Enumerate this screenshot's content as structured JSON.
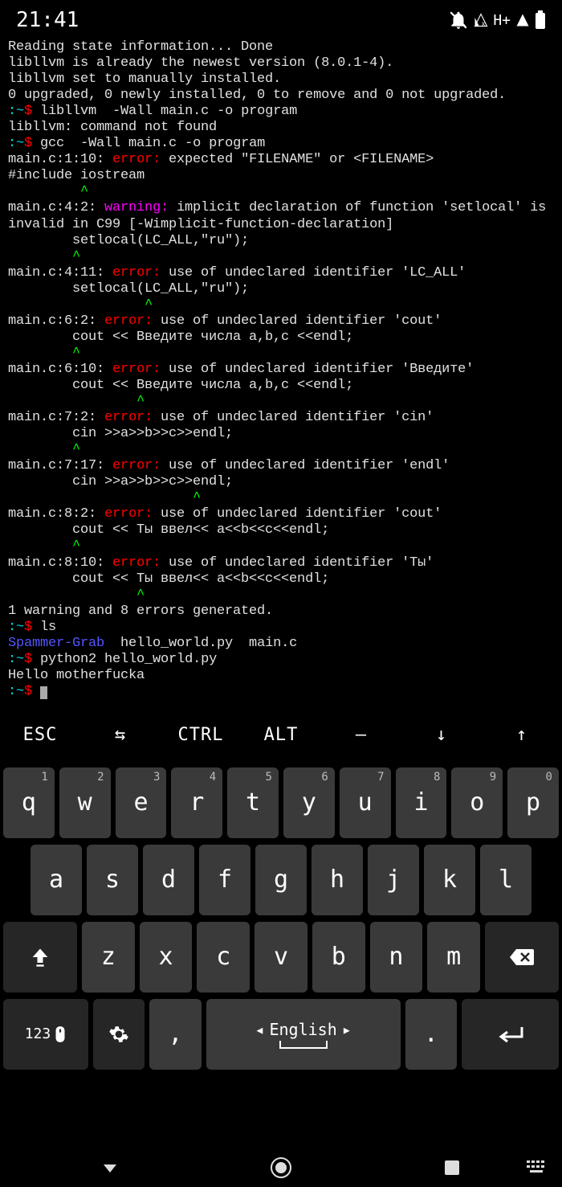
{
  "status": {
    "time": "21:41",
    "network": "H+"
  },
  "terminal": {
    "lines": [
      {
        "segs": [
          {
            "t": "Reading state information... Done"
          }
        ]
      },
      {
        "segs": [
          {
            "t": "libllvm is already the newest version (8.0.1-4)."
          }
        ]
      },
      {
        "segs": [
          {
            "t": "libllvm set to manually installed."
          }
        ]
      },
      {
        "segs": [
          {
            "t": "0 upgraded, 0 newly installed, 0 to remove and 0 not upgraded."
          }
        ]
      },
      {
        "prompt": true,
        "cmd": " libllvm  -Wall main.c -o program"
      },
      {
        "segs": [
          {
            "t": "libllvm: command not found"
          }
        ]
      },
      {
        "prompt": true,
        "cmd": " gcc  -Wall main.c -o program"
      },
      {
        "segs": [
          {
            "t": "main.c:1:10: ",
            "c": ""
          },
          {
            "t": "error:",
            "c": "t-red"
          },
          {
            "t": " expected \"FILENAME\" or <FILENAME>"
          }
        ]
      },
      {
        "segs": [
          {
            "t": "#include iostream"
          }
        ]
      },
      {
        "segs": [
          {
            "t": "         ^",
            "c": "t-green"
          }
        ]
      },
      {
        "segs": [
          {
            "t": "main.c:4:2: "
          },
          {
            "t": "warning:",
            "c": "t-magenta"
          },
          {
            "t": " implicit declaration of function 'setlocal' is invalid in C99 [-Wimplicit-function-declaration]"
          }
        ]
      },
      {
        "segs": [
          {
            "t": "        setlocal(LC_ALL,\"ru\");"
          }
        ]
      },
      {
        "segs": [
          {
            "t": "        ^",
            "c": "t-green"
          }
        ]
      },
      {
        "segs": [
          {
            "t": "main.c:4:11: "
          },
          {
            "t": "error:",
            "c": "t-red"
          },
          {
            "t": " use of undeclared identifier 'LC_ALL'"
          }
        ]
      },
      {
        "segs": [
          {
            "t": "        setlocal(LC_ALL,\"ru\");"
          }
        ]
      },
      {
        "segs": [
          {
            "t": "                 ^",
            "c": "t-green"
          }
        ]
      },
      {
        "segs": [
          {
            "t": "main.c:6:2: "
          },
          {
            "t": "error:",
            "c": "t-red"
          },
          {
            "t": " use of undeclared identifier 'cout'"
          }
        ]
      },
      {
        "segs": [
          {
            "t": "        cout << Введите числа a,b,c <<endl;"
          }
        ]
      },
      {
        "segs": [
          {
            "t": "        ^",
            "c": "t-green"
          }
        ]
      },
      {
        "segs": [
          {
            "t": "main.c:6:10: "
          },
          {
            "t": "error:",
            "c": "t-red"
          },
          {
            "t": " use of undeclared identifier 'Введите'"
          }
        ]
      },
      {
        "segs": [
          {
            "t": "        cout << Введите числа a,b,c <<endl;"
          }
        ]
      },
      {
        "segs": [
          {
            "t": "                ^",
            "c": "t-green"
          }
        ]
      },
      {
        "segs": [
          {
            "t": "main.c:7:2: "
          },
          {
            "t": "error:",
            "c": "t-red"
          },
          {
            "t": " use of undeclared identifier 'cin'"
          }
        ]
      },
      {
        "segs": [
          {
            "t": "        cin >>a>>b>>c>>endl;"
          }
        ]
      },
      {
        "segs": [
          {
            "t": "        ^",
            "c": "t-green"
          }
        ]
      },
      {
        "segs": [
          {
            "t": "main.c:7:17: "
          },
          {
            "t": "error:",
            "c": "t-red"
          },
          {
            "t": " use of undeclared identifier 'endl'"
          }
        ]
      },
      {
        "segs": [
          {
            "t": "        cin >>a>>b>>c>>endl;"
          }
        ]
      },
      {
        "segs": [
          {
            "t": "                       ^",
            "c": "t-green"
          }
        ]
      },
      {
        "segs": [
          {
            "t": "main.c:8:2: "
          },
          {
            "t": "error:",
            "c": "t-red"
          },
          {
            "t": " use of undeclared identifier 'cout'"
          }
        ]
      },
      {
        "segs": [
          {
            "t": "        cout << Ты ввел<< a<<b<<c<<endl;"
          }
        ]
      },
      {
        "segs": [
          {
            "t": "        ^",
            "c": "t-green"
          }
        ]
      },
      {
        "segs": [
          {
            "t": "main.c:8:10: "
          },
          {
            "t": "error:",
            "c": "t-red"
          },
          {
            "t": " use of undeclared identifier 'Ты'"
          }
        ]
      },
      {
        "segs": [
          {
            "t": "        cout << Ты ввел<< a<<b<<c<<endl;"
          }
        ]
      },
      {
        "segs": [
          {
            "t": "                ^",
            "c": "t-green"
          }
        ]
      },
      {
        "segs": [
          {
            "t": "1 warning and 8 errors generated."
          }
        ]
      },
      {
        "prompt": true,
        "cmd": " ls"
      },
      {
        "segs": [
          {
            "t": "Spammer-Grab",
            "c": "t-blue"
          },
          {
            "t": "  hello_world.py  main.c"
          }
        ]
      },
      {
        "prompt": true,
        "cmd": " python2 hello_world.py"
      },
      {
        "segs": [
          {
            "t": "Hello motherfucka"
          }
        ]
      },
      {
        "prompt": true,
        "cmd": " ",
        "cursor": true
      }
    ]
  },
  "extraKeys": [
    "ESC",
    "⇆",
    "CTRL",
    "ALT",
    "—",
    "↓",
    "↑"
  ],
  "keyboard": {
    "row1": [
      {
        "l": "q",
        "n": "1"
      },
      {
        "l": "w",
        "n": "2"
      },
      {
        "l": "e",
        "n": "3"
      },
      {
        "l": "r",
        "n": "4"
      },
      {
        "l": "t",
        "n": "5"
      },
      {
        "l": "y",
        "n": "6"
      },
      {
        "l": "u",
        "n": "7"
      },
      {
        "l": "i",
        "n": "8"
      },
      {
        "l": "o",
        "n": "9"
      },
      {
        "l": "p",
        "n": "0"
      }
    ],
    "row2": [
      {
        "l": "a"
      },
      {
        "l": "s"
      },
      {
        "l": "d"
      },
      {
        "l": "f"
      },
      {
        "l": "g"
      },
      {
        "l": "h"
      },
      {
        "l": "j"
      },
      {
        "l": "k"
      },
      {
        "l": "l"
      }
    ],
    "row3": [
      {
        "l": "z"
      },
      {
        "l": "x"
      },
      {
        "l": "c"
      },
      {
        "l": "v"
      },
      {
        "l": "b"
      },
      {
        "l": "n"
      },
      {
        "l": "m"
      }
    ],
    "row4": {
      "num123": "123",
      "comma": ",",
      "space": "English",
      "dot": "."
    }
  }
}
